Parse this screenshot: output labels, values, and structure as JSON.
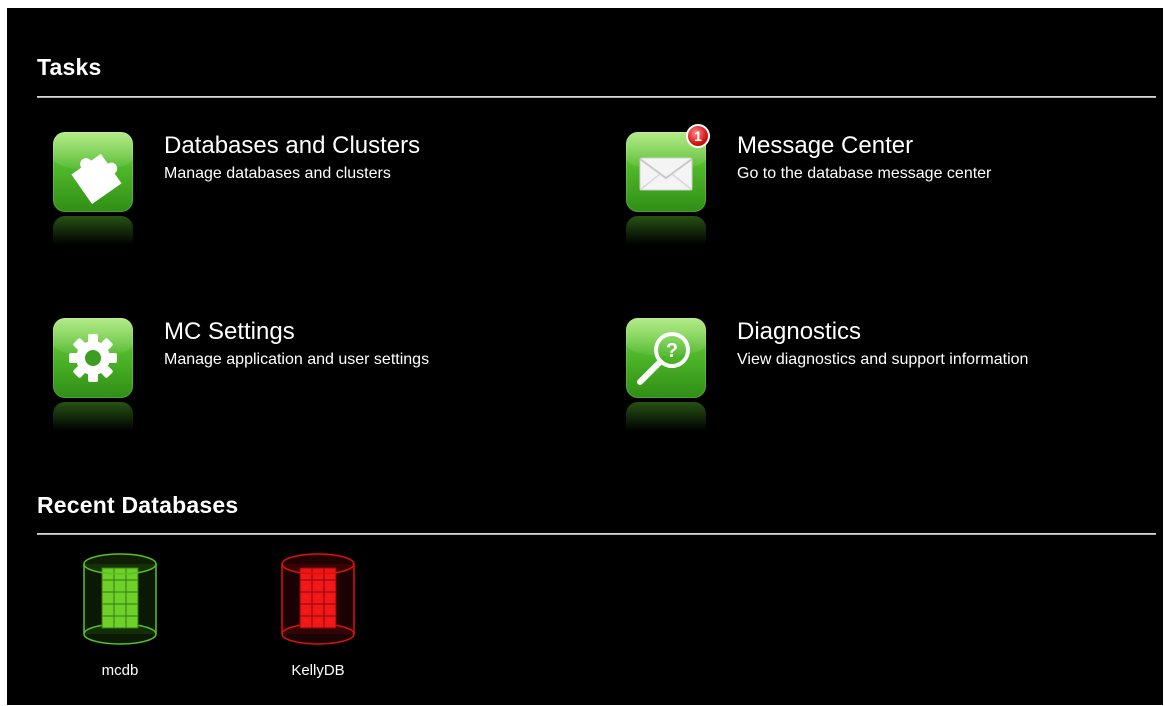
{
  "tasks_section": {
    "title": "Tasks"
  },
  "tasks": [
    {
      "title": "Databases and Clusters",
      "description": "Manage databases and clusters",
      "icon": "puzzle-icon"
    },
    {
      "title": "Message Center",
      "description": "Go to the database message center",
      "icon": "envelope-icon",
      "badge": "1"
    },
    {
      "title": "MC Settings",
      "description": "Manage application and user settings",
      "icon": "gear-icon"
    },
    {
      "title": "Diagnostics",
      "description": "View diagnostics and support information",
      "icon": "magnifier-question-icon"
    }
  ],
  "recent_section": {
    "title": "Recent Databases"
  },
  "recent_databases": [
    {
      "name": "mcdb",
      "status_color": "#5cc21e",
      "icon": "database-cylinder-icon"
    },
    {
      "name": "KellyDB",
      "status_color": "#e01010",
      "icon": "database-cylinder-icon"
    }
  ],
  "colors": {
    "background": "#000000",
    "tile_green": "#4fb82a",
    "badge_red": "#d81414"
  }
}
